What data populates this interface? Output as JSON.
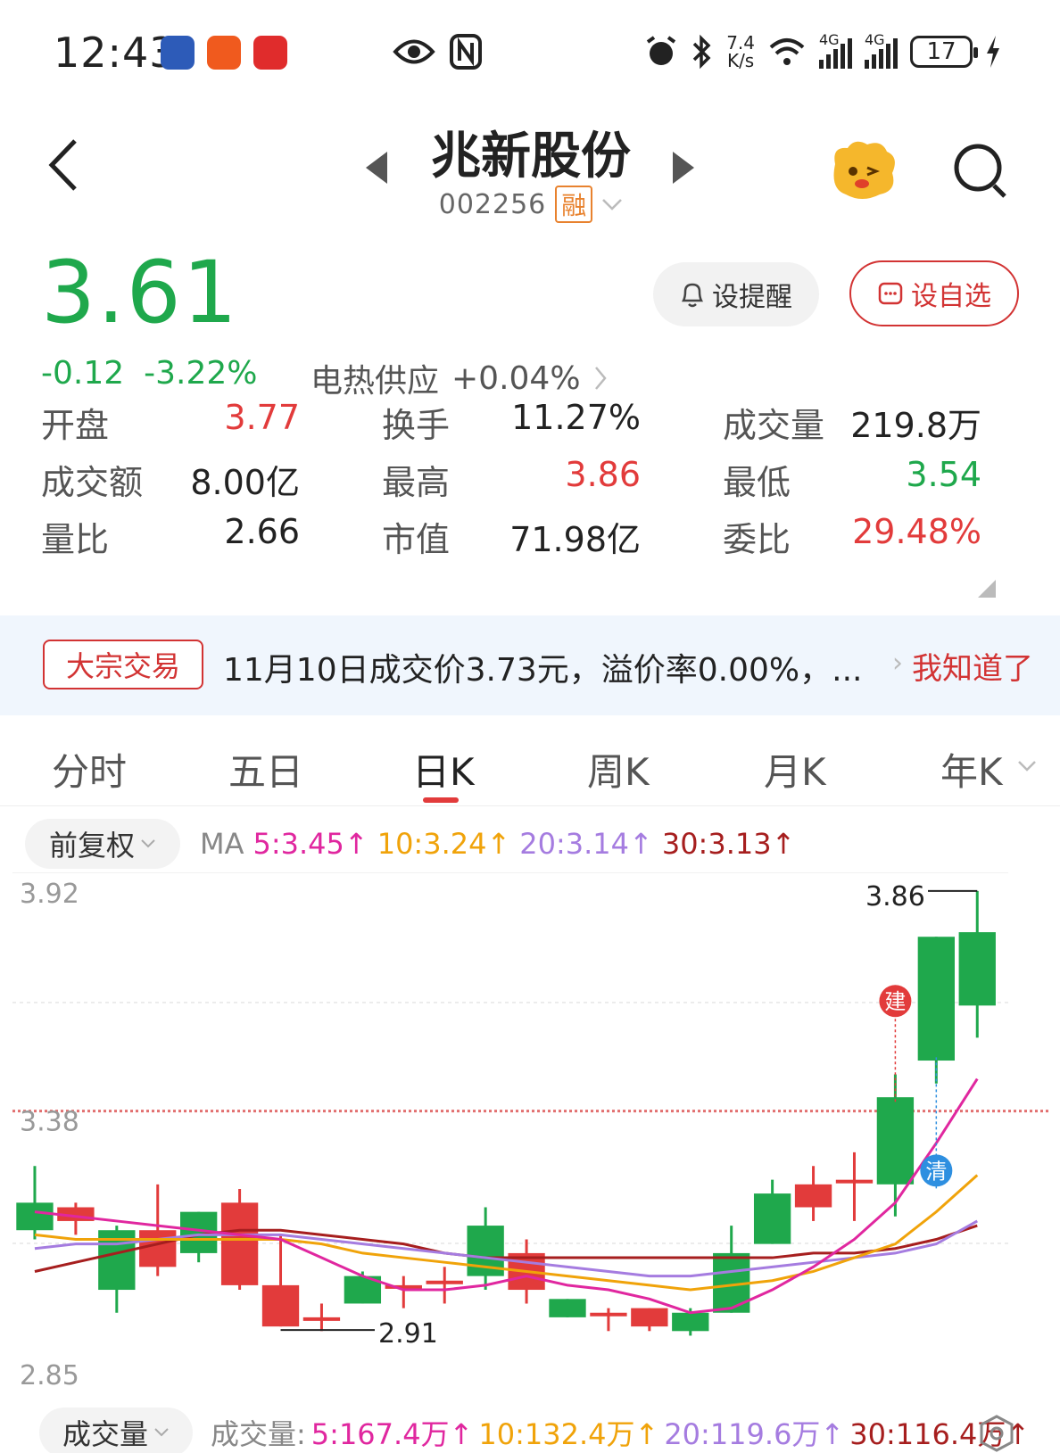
{
  "status_bar": {
    "time": "12:43",
    "net_speed_top": "7.4",
    "net_speed_bottom": "K/s",
    "signal1": "4G",
    "signal2": "4G",
    "battery": "17"
  },
  "header": {
    "stock_name": "兆新股份",
    "stock_code": "002256",
    "badge": "融"
  },
  "price": {
    "current": "3.61",
    "change": "-0.12",
    "change_pct": "-3.22%",
    "sector": "电热供应",
    "sector_change": "+0.04%"
  },
  "actions": {
    "remind": "设提醒",
    "watch": "设自选"
  },
  "quotes": [
    {
      "label": "开盘",
      "value": "3.77",
      "color": "#e23b3b"
    },
    {
      "label": "换手",
      "value": "11.27%",
      "color": "#222222"
    },
    {
      "label": "成交量",
      "value": "219.8万",
      "color": "#222222"
    },
    {
      "label": "成交额",
      "value": "8.00亿",
      "color": "#222222"
    },
    {
      "label": "最高",
      "value": "3.86",
      "color": "#e23b3b"
    },
    {
      "label": "最低",
      "value": "3.54",
      "color": "#1fa84c"
    },
    {
      "label": "量比",
      "value": "2.66",
      "color": "#222222"
    },
    {
      "label": "市值",
      "value": "71.98亿",
      "color": "#222222"
    },
    {
      "label": "委比",
      "value": "29.48%",
      "color": "#e23b3b"
    }
  ],
  "banner": {
    "tag": "大宗交易",
    "text": "11月10日成交价3.73元，溢价率0.00%，...",
    "action": "我知道了"
  },
  "tabs": [
    "分时",
    "五日",
    "日K",
    "周K",
    "月K",
    "年K"
  ],
  "active_tab": "日K",
  "ma": {
    "adjust": "前复权",
    "label": "MA",
    "items": [
      {
        "text": "5:3.45↑",
        "color": "#e0279f"
      },
      {
        "text": "10:3.24↑",
        "color": "#f0a30a"
      },
      {
        "text": "20:3.14↑",
        "color": "#a57ce0"
      },
      {
        "text": "30:3.13↑",
        "color": "#a61e1e"
      }
    ]
  },
  "chart_data": {
    "type": "candlestick",
    "ylim": [
      2.85,
      3.92
    ],
    "y_top_label": "3.92",
    "y_mid_label": "3.38",
    "y_bottom_label": "2.85",
    "prev_close_line": 3.38,
    "high_label": "3.86",
    "low_label": "2.91",
    "markers": [
      {
        "text": "建",
        "color": "#e23b3b",
        "index": 21
      },
      {
        "text": "清",
        "color": "#2e8fe0",
        "index": 22
      }
    ],
    "candles": [
      {
        "o": 3.18,
        "c": 3.12,
        "h": 3.26,
        "l": 3.1
      },
      {
        "o": 3.14,
        "c": 3.17,
        "h": 3.18,
        "l": 3.11
      },
      {
        "o": 3.12,
        "c": 2.99,
        "h": 3.13,
        "l": 2.94
      },
      {
        "o": 3.04,
        "c": 3.12,
        "h": 3.22,
        "l": 3.02
      },
      {
        "o": 3.16,
        "c": 3.07,
        "h": 3.16,
        "l": 3.05
      },
      {
        "o": 3.0,
        "c": 3.18,
        "h": 3.21,
        "l": 2.99
      },
      {
        "o": 2.91,
        "c": 3.0,
        "h": 3.11,
        "l": 2.91
      },
      {
        "o": 2.93,
        "c": 2.93,
        "h": 2.96,
        "l": 2.9
      },
      {
        "o": 3.02,
        "c": 2.96,
        "h": 3.03,
        "l": 2.96
      },
      {
        "o": 3.0,
        "c": 3.0,
        "h": 3.02,
        "l": 2.95
      },
      {
        "o": 3.01,
        "c": 3.01,
        "h": 3.04,
        "l": 2.96
      },
      {
        "o": 3.13,
        "c": 3.02,
        "h": 3.17,
        "l": 2.99
      },
      {
        "o": 2.99,
        "c": 3.07,
        "h": 3.1,
        "l": 2.96
      },
      {
        "o": 2.97,
        "c": 2.93,
        "h": 2.97,
        "l": 2.93
      },
      {
        "o": 2.94,
        "c": 2.94,
        "h": 2.95,
        "l": 2.9
      },
      {
        "o": 2.91,
        "c": 2.95,
        "h": 2.95,
        "l": 2.9
      },
      {
        "o": 2.94,
        "c": 2.9,
        "h": 2.95,
        "l": 2.89
      },
      {
        "o": 3.07,
        "c": 2.94,
        "h": 3.13,
        "l": 2.94
      },
      {
        "o": 3.2,
        "c": 3.09,
        "h": 3.23,
        "l": 3.09
      },
      {
        "o": 3.17,
        "c": 3.22,
        "h": 3.26,
        "l": 3.14
      },
      {
        "o": 3.23,
        "c": 3.23,
        "h": 3.29,
        "l": 3.14
      },
      {
        "o": 3.41,
        "c": 3.22,
        "h": 3.46,
        "l": 3.15
      },
      {
        "o": 3.76,
        "c": 3.49,
        "h": 3.76,
        "l": 3.44
      },
      {
        "o": 3.77,
        "c": 3.61,
        "h": 3.86,
        "l": 3.54
      }
    ],
    "ma5": [
      3.16,
      3.15,
      3.14,
      3.13,
      3.12,
      3.11,
      3.1,
      3.06,
      3.02,
      2.99,
      2.99,
      3.0,
      3.02,
      3.0,
      2.99,
      2.97,
      2.94,
      2.95,
      2.99,
      3.04,
      3.1,
      3.18,
      3.31,
      3.45
    ],
    "ma10": [
      3.11,
      3.1,
      3.1,
      3.1,
      3.1,
      3.1,
      3.1,
      3.09,
      3.07,
      3.06,
      3.05,
      3.04,
      3.03,
      3.02,
      3.01,
      3.0,
      2.99,
      3.0,
      3.01,
      3.03,
      3.06,
      3.09,
      3.16,
      3.24
    ],
    "ma20": [
      3.08,
      3.09,
      3.09,
      3.1,
      3.11,
      3.11,
      3.11,
      3.1,
      3.09,
      3.08,
      3.07,
      3.06,
      3.05,
      3.04,
      3.03,
      3.02,
      3.02,
      3.03,
      3.04,
      3.05,
      3.06,
      3.07,
      3.09,
      3.14
    ],
    "ma30": [
      3.03,
      3.05,
      3.07,
      3.09,
      3.11,
      3.12,
      3.12,
      3.11,
      3.1,
      3.09,
      3.07,
      3.06,
      3.06,
      3.06,
      3.06,
      3.06,
      3.06,
      3.06,
      3.06,
      3.07,
      3.07,
      3.08,
      3.1,
      3.13
    ]
  },
  "volume": {
    "selector": "成交量",
    "label": "成交量:",
    "items": [
      {
        "text": "5:167.4万↑",
        "color": "#e0279f"
      },
      {
        "text": "10:132.4万↑",
        "color": "#f0a30a"
      },
      {
        "text": "20:119.6万↑",
        "color": "#a57ce0"
      },
      {
        "text": "30:116.4万↑",
        "color": "#a61e1e"
      }
    ]
  },
  "colors": {
    "up": "#e23b3b",
    "down": "#1fa84c"
  }
}
